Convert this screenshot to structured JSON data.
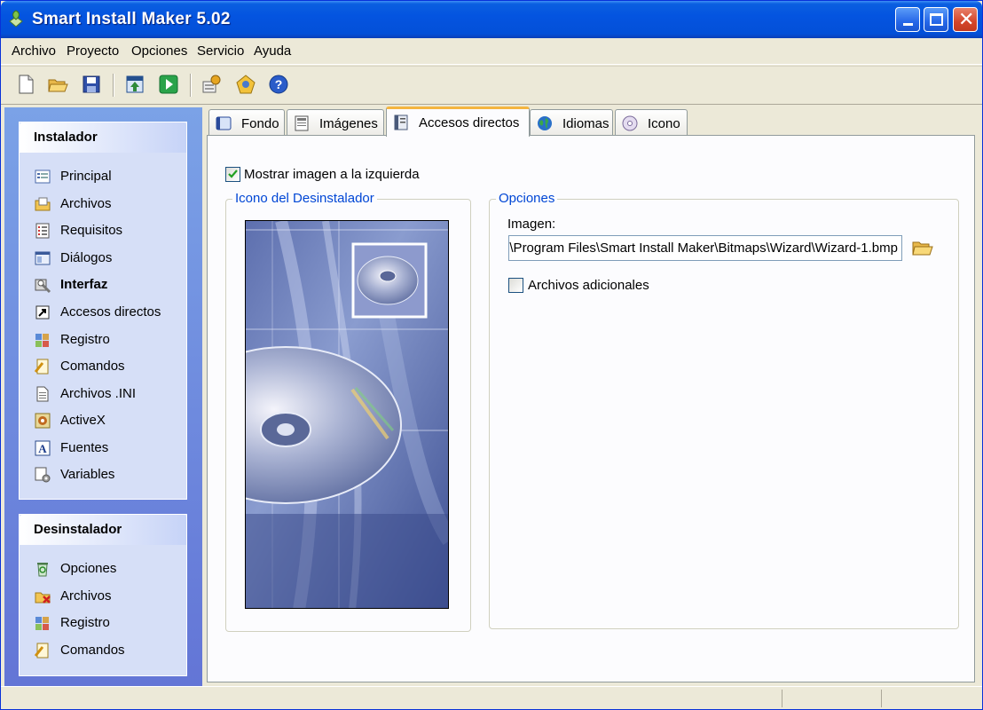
{
  "window": {
    "title": "Smart Install Maker 5.02"
  },
  "menu": [
    "Archivo",
    "Proyecto",
    "Opciones",
    "Servicio",
    "Ayuda"
  ],
  "toolbar": {
    "buttons": [
      "new-file-icon",
      "open-folder-icon",
      "save-icon",
      "build-icon",
      "run-icon",
      "settings-icon",
      "web-icon",
      "help-icon"
    ]
  },
  "sidebar": {
    "installer": {
      "title": "Instalador",
      "items": [
        "Principal",
        "Archivos",
        "Requisitos",
        "Diálogos",
        "Interfaz",
        "Accesos directos",
        "Registro",
        "Comandos",
        "Archivos .INI",
        "ActiveX",
        "Fuentes",
        "Variables"
      ],
      "active": "Interfaz"
    },
    "uninstaller": {
      "title": "Desinstalador",
      "items": [
        "Opciones",
        "Archivos",
        "Registro",
        "Comandos"
      ]
    }
  },
  "tabs": {
    "items": [
      "Fondo",
      "Imágenes",
      "Accesos directos",
      "Idiomas",
      "Icono"
    ],
    "active": "Accesos directos"
  },
  "content": {
    "show_left_image_label": "Mostrar imagen a la izquierda",
    "show_left_image_checked": true,
    "preview_group_label": "Icono del Desinstalador",
    "options_group_label": "Opciones",
    "image_label": "Imagen:",
    "image_path": "\\Program Files\\Smart Install Maker\\Bitmaps\\Wizard\\Wizard-1.bmp",
    "additional_files_label": "Archivos adicionales",
    "additional_files_checked": false
  },
  "colors": {
    "titlebar": "#0454e0",
    "sidebar_gradient_top": "#7ba2e7",
    "legend_text": "#0046d5",
    "active_tab_accent": "#f4b540"
  }
}
